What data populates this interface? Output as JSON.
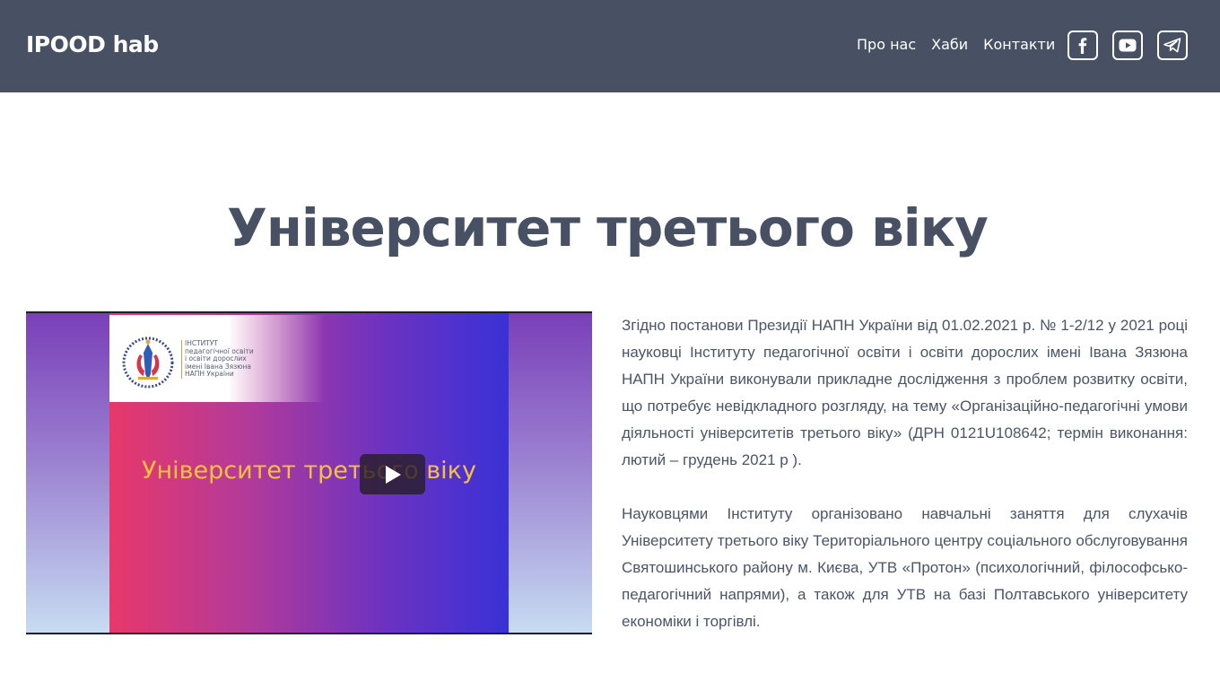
{
  "header": {
    "brand": "IPOOD hab",
    "nav": [
      {
        "label": "Про нас"
      },
      {
        "label": "Хаби"
      },
      {
        "label": "Контакти"
      }
    ],
    "social": [
      {
        "icon": "facebook-icon"
      },
      {
        "icon": "youtube-icon"
      },
      {
        "icon": "telegram-icon"
      }
    ]
  },
  "page": {
    "title": "Університет третього віку"
  },
  "video": {
    "logo_lines": [
      "ІНСТИТУТ",
      "педагогічної освіти",
      "і освіти дорослих",
      "імені Івана Зязюна",
      "НАПН України"
    ],
    "slide_title": "Університет третього віку",
    "play_icon": "play-icon"
  },
  "content": {
    "paragraphs": [
      "Згідно постанови Президії НАПН України від 01.02.2021 р. № 1-2/12 у 2021 році науковці Інституту педагогічної освіти і освіти дорослих імені Івана Зязюна НАПН України виконували прикладне дослідження з проблем розвитку освіти, що потребує невідкладного розгляду, на тему «Організаційно-педагогічні умови діяльності університетів третього віку» (ДРН 0121U108642; термін виконання: лютий – грудень 2021 р ).",
      "Науковцями Інституту організовано навчальні заняття для слухачів Університету третього віку Територіального центру соціального обслуговування Святошинського району м. Києва, УТВ «Протон» (психологічний, філософсько-педагогічний напрями), а також для УТВ на базі Полтавського університету економіки і торгівлі."
    ]
  },
  "colors": {
    "header_bg": "#475163",
    "title": "#475163",
    "body_text": "#4a5568",
    "slide_title": "#f6c13c"
  }
}
